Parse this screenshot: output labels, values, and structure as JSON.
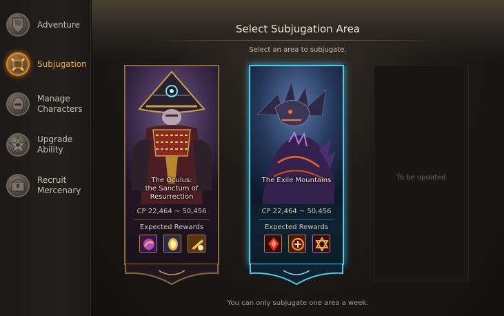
{
  "sidebar": {
    "items": [
      {
        "label": "Adventure",
        "active": false,
        "icon": "shield-flag-icon"
      },
      {
        "label": "Subjugation",
        "active": true,
        "icon": "crossed-swords-icon"
      },
      {
        "label": "Manage Characters",
        "active": false,
        "icon": "helmet-icon"
      },
      {
        "label": "Upgrade Ability",
        "active": false,
        "icon": "star-burst-icon"
      },
      {
        "label": "Recruit Mercenary",
        "active": false,
        "icon": "treasure-chest-icon"
      }
    ]
  },
  "main": {
    "title": "Select Subjugation Area",
    "subtitle": "Select an area to subjugate.",
    "footer": "You can only subjugate one area a week."
  },
  "areas": [
    {
      "name_lines": [
        "The Oculus:",
        "the Sanctum of",
        "Resurrection"
      ],
      "cp": "CP 22,464 ~ 50,456",
      "rewards_label": "Expected Rewards",
      "rewards": [
        "purple-orb-reward-icon",
        "golden-egg-reward-icon",
        "golden-scroll-reward-icon"
      ],
      "frame_color": "#8b6a3d"
    },
    {
      "name_lines": [
        "The Exile Mountains"
      ],
      "cp": "CP 22,464 ~ 50,456",
      "rewards_label": "Expected Rewards",
      "rewards": [
        "red-crystal-reward-icon",
        "red-rune-reward-icon",
        "hexagram-reward-icon"
      ],
      "frame_color": "#56c8e6"
    }
  ],
  "empty_slot": {
    "text": "To be updated"
  }
}
